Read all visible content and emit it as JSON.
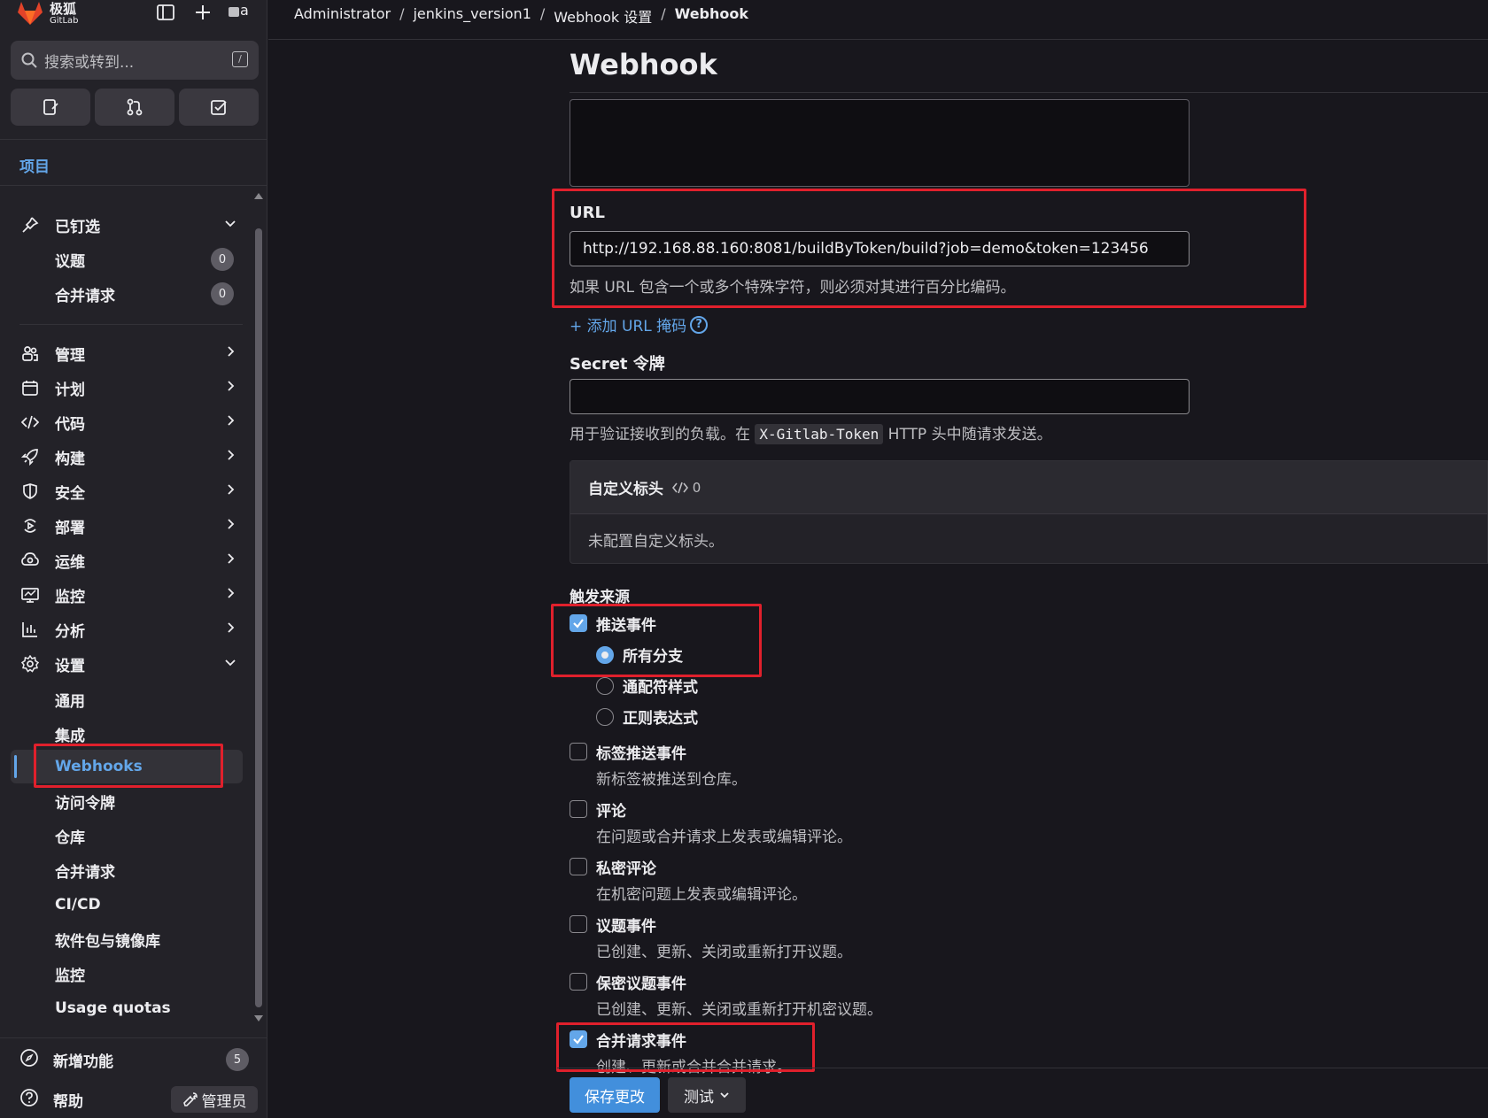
{
  "app": {
    "brand_name": "极狐",
    "brand_sub": "GitLab",
    "avatar_alt": "a"
  },
  "search": {
    "placeholder": "搜索或转到...",
    "shortcut": "/"
  },
  "sidebar": {
    "section_title": "项目",
    "pinned": {
      "label": "已钉选",
      "items": [
        {
          "label": "议题",
          "count": "0"
        },
        {
          "label": "合并请求",
          "count": "0"
        }
      ]
    },
    "groups": [
      {
        "label": "管理",
        "icon": "users-icon"
      },
      {
        "label": "计划",
        "icon": "calendar-icon"
      },
      {
        "label": "代码",
        "icon": "code-icon"
      },
      {
        "label": "构建",
        "icon": "rocket-icon"
      },
      {
        "label": "安全",
        "icon": "shield-icon"
      },
      {
        "label": "部署",
        "icon": "deploy-icon"
      },
      {
        "label": "运维",
        "icon": "cloud-icon"
      },
      {
        "label": "监控",
        "icon": "monitor-icon"
      },
      {
        "label": "分析",
        "icon": "chart-icon"
      }
    ],
    "settings": {
      "label": "设置",
      "items": [
        {
          "label": "通用"
        },
        {
          "label": "集成"
        },
        {
          "label": "Webhooks"
        },
        {
          "label": "访问令牌"
        },
        {
          "label": "仓库"
        },
        {
          "label": "合并请求"
        },
        {
          "label": "CI/CD"
        },
        {
          "label": "软件包与镜像库"
        },
        {
          "label": "监控"
        },
        {
          "label": "Usage quotas"
        }
      ]
    },
    "footer": {
      "whats_new": "新增功能",
      "whats_new_count": "5",
      "help": "帮助",
      "admin": "管理员"
    }
  },
  "breadcrumb": [
    "Administrator",
    "jenkins_version1",
    "Webhook 设置",
    "Webhook"
  ],
  "page": {
    "title": "Webhook",
    "url_label": "URL",
    "url_value": "http://192.168.88.160:8081/buildByToken/build?job=demo&token=123456",
    "url_help": "如果 URL 包含一个或多个特殊字符，则必须对其进行百分比编码。",
    "add_mask": "+ 添加 URL 掩码",
    "secret_label": "Secret 令牌",
    "secret_value": "",
    "secret_help_pre": "用于验证接收到的负载。在",
    "secret_help_code": "X-Gitlab-Token",
    "secret_help_post": "HTTP 头中随请求发送。",
    "custom_headers_title": "自定义标头",
    "custom_headers_count": "0",
    "custom_headers_empty": "未配置自定义标头。",
    "triggers_label": "触发来源",
    "push_events": {
      "label": "推送事件",
      "checked": true
    },
    "branch_options": [
      {
        "label": "所有分支",
        "selected": true
      },
      {
        "label": "通配符样式",
        "selected": false
      },
      {
        "label": "正则表达式",
        "selected": false
      }
    ],
    "events": [
      {
        "label": "标签推送事件",
        "desc": "新标签被推送到仓库。",
        "checked": false
      },
      {
        "label": "评论",
        "desc": "在问题或合并请求上发表或编辑评论。",
        "checked": false
      },
      {
        "label": "私密评论",
        "desc": "在机密问题上发表或编辑评论。",
        "checked": false
      },
      {
        "label": "议题事件",
        "desc": "已创建、更新、关闭或重新打开议题。",
        "checked": false
      },
      {
        "label": "保密议题事件",
        "desc": "已创建、更新、关闭或重新打开机密议题。",
        "checked": false
      },
      {
        "label": "合并请求事件",
        "desc": "创建、更新或合并合并请求。",
        "checked": true
      }
    ],
    "save_button": "保存更改",
    "test_button": "测试"
  }
}
